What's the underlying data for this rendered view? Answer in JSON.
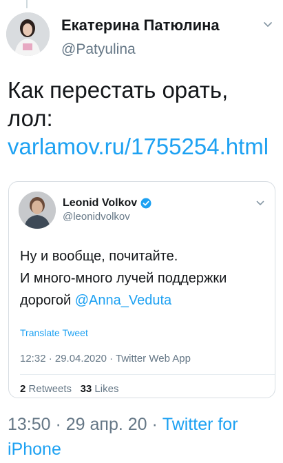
{
  "author": {
    "name": "Екатерина Патюлина",
    "handle": "@Patyulina"
  },
  "tweet": {
    "text_before": "Как перестать орать, лол: ",
    "link": "varlamov.ru/1755254.html"
  },
  "quoted": {
    "name": "Leonid Volkov",
    "handle": "@leonidvolkov",
    "text_line1": "Ну и вообще, почитайте.",
    "text_line2": "И много-много лучей поддержки",
    "text_line3_before": "дорогой ",
    "mention": "@Anna_Veduta",
    "translate": "Translate Tweet",
    "meta": "12:32 · 29.04.2020 · Twitter Web App",
    "retweets_count": "2",
    "retweets_label": "Retweets",
    "likes_count": "33",
    "likes_label": "Likes"
  },
  "bottom": {
    "time": "13:50 · 29 апр. 20 · ",
    "source": "Twitter for iPhone"
  },
  "colors": {
    "accent": "#1da1f2",
    "muted": "#657786",
    "verified": "#1da1f2"
  },
  "icons": [
    "chevron-down-icon",
    "verified-badge-icon"
  ]
}
